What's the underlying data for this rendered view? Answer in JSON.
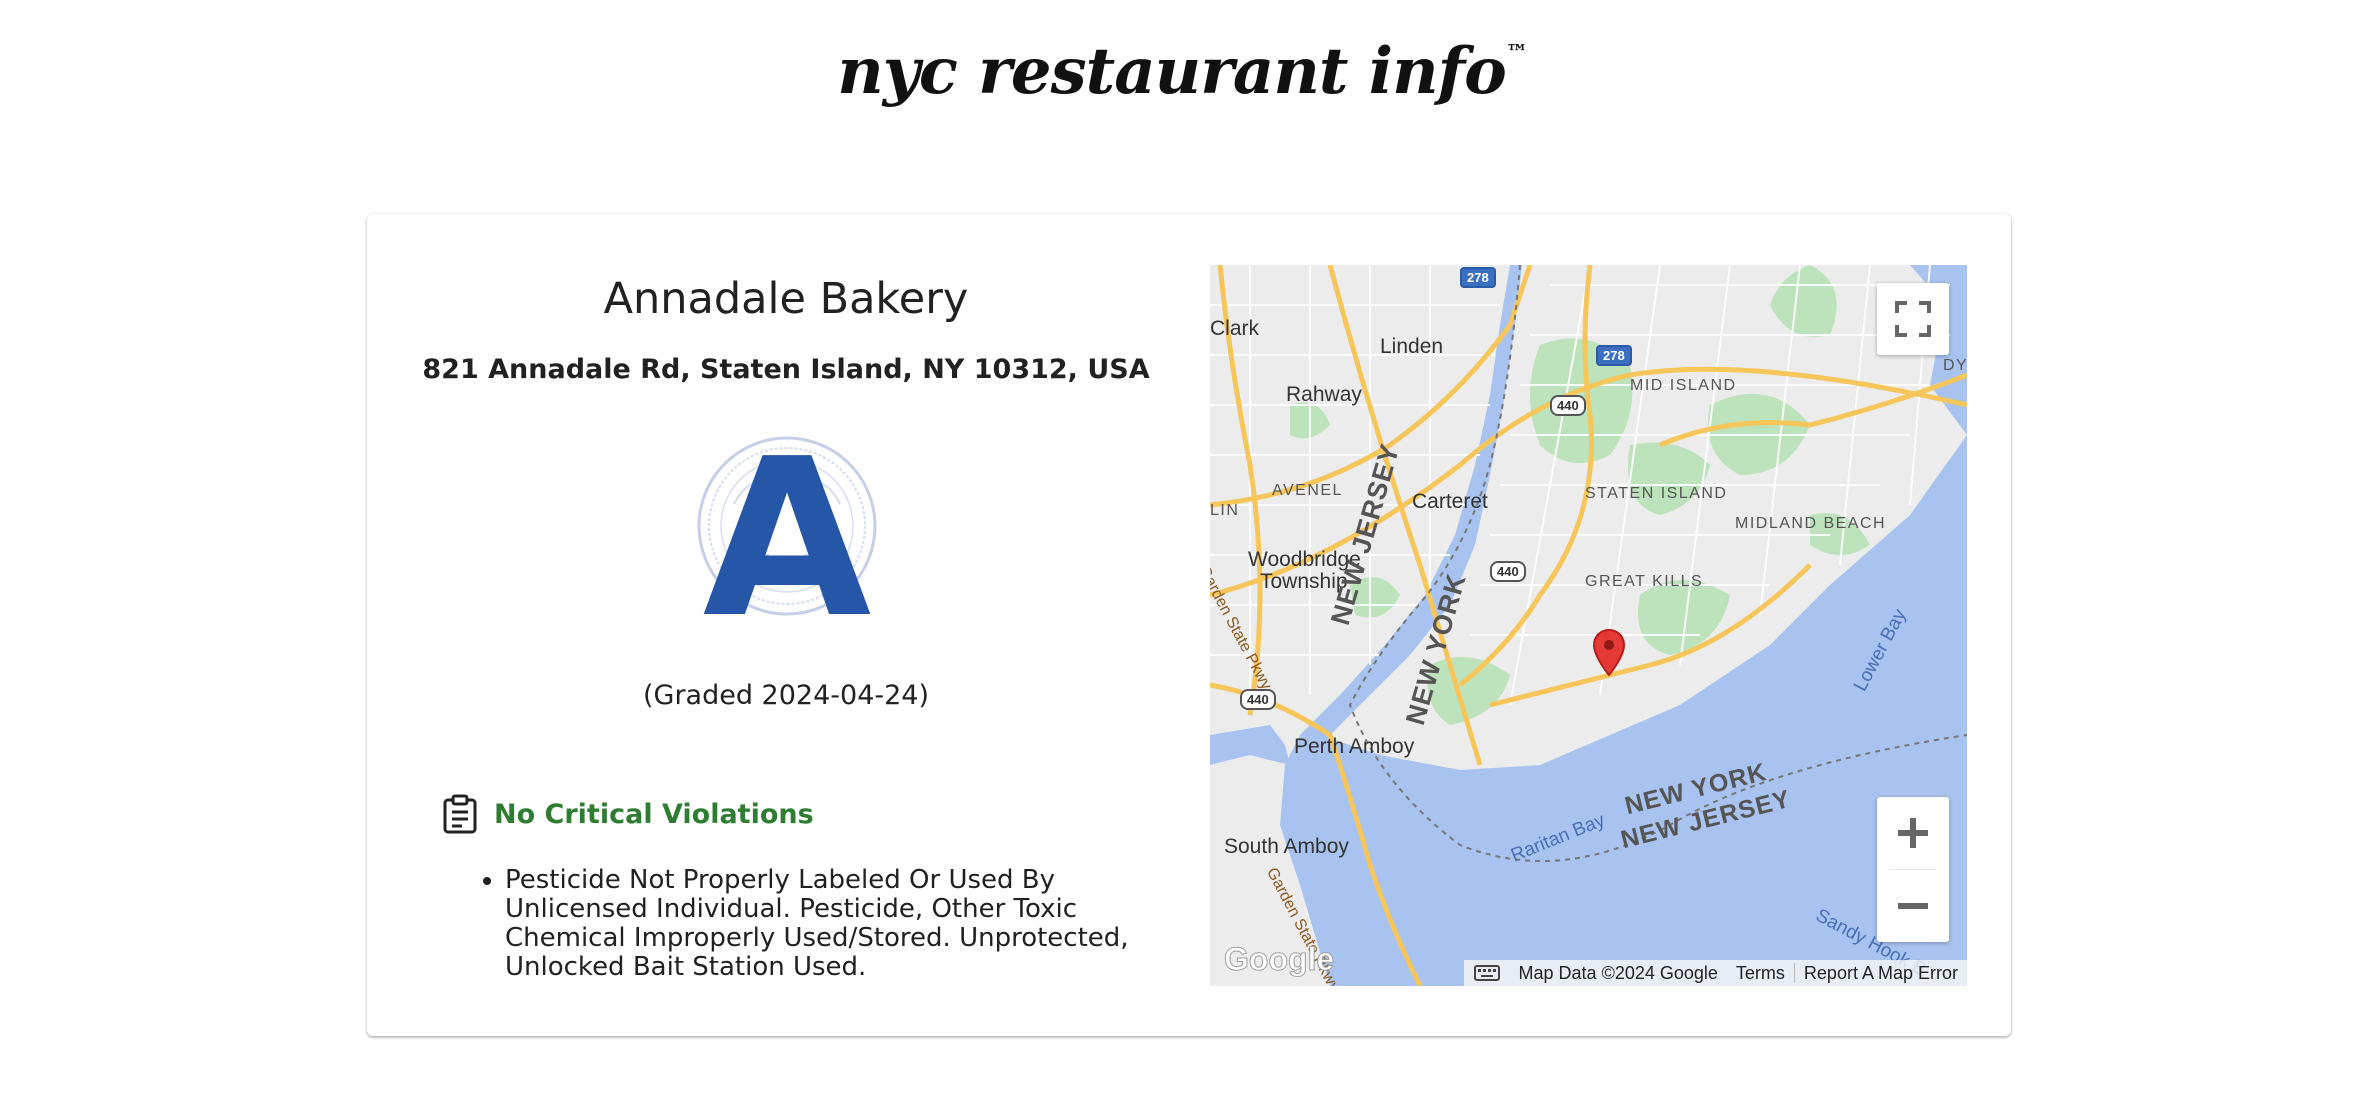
{
  "site": {
    "title": "nyc restaurant info",
    "trademark": "™"
  },
  "restaurant": {
    "name": "Annadale Bakery",
    "address": "821 Annadale Rd, Staten Island, NY 10312, USA",
    "grade": "A",
    "graded_text": "(Graded 2024-04-24)"
  },
  "violations": {
    "header": "No Critical Violations",
    "header_color": "#2e7d32",
    "items": [
      "Pesticide Not Properly Labeled Or Used By Unlicensed Individual. Pesticide, Other Toxic Chemical Improperly Used/Stored. Unprotected, Unlocked Bait Station Used."
    ]
  },
  "map": {
    "labels": {
      "clark": "Clark",
      "linden": "Linden",
      "rahway": "Rahway",
      "avenel": "AVENEL",
      "carteret": "Carteret",
      "woodbridge": "Woodbridge",
      "township": "Township",
      "mid_island": "MID ISLAND",
      "staten_island": "STATEN ISLAND",
      "midland_beach": "MIDLAND BEACH",
      "great_kills": "GREAT KILLS",
      "new_jersey": "NEW JERSEY",
      "new_york": "NEW YORK",
      "perth_amboy": "Perth Amboy",
      "south_amboy": "South Amboy",
      "lower_bay": "Lower Bay",
      "raritan_bay": "Raritan Bay",
      "new_york_2": "NEW YORK",
      "new_jersey_2": "NEW JERSEY",
      "garden_state_pkwy": "Garden State Pkwy",
      "garden_state_pkwy_2": "Garden State Pkwy",
      "sandy_hook": "Sandy Hook B",
      "dyk": "DYK",
      "lin": "LIN"
    },
    "shields": {
      "i278_top": "278",
      "i278_right": "278",
      "r440_a": "440",
      "r440_b": "440",
      "r440_c": "440"
    },
    "google_logo": "Google",
    "attribution": {
      "map_data": "Map Data ©2024 Google",
      "terms": "Terms",
      "report": "Report A Map Error"
    },
    "colors": {
      "water": "#a8c3f0",
      "land": "#ececec",
      "park": "#bde3bc",
      "highway": "#f6c65a",
      "marker": "#e53935"
    }
  },
  "icons": {
    "clipboard": "clipboard-icon",
    "fullscreen": "fullscreen-icon",
    "zoom_in": "plus-icon",
    "zoom_out": "minus-icon",
    "keyboard": "keyboard-icon",
    "marker": "map-pin-icon"
  }
}
